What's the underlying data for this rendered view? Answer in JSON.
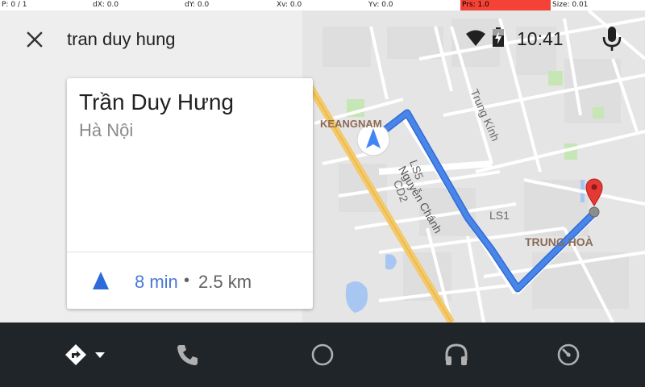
{
  "debug": {
    "p": "P: 0 / 1",
    "dx": "dX: 0.0",
    "dy": "dY: 0.0",
    "xv": "Xv: 0.0",
    "yv": "Yv: 0.0",
    "prs": "Prs: 1.0",
    "size": "Size: 0.01"
  },
  "search": {
    "query": "tran duy hung"
  },
  "status": {
    "time": "10:41"
  },
  "result": {
    "title": "Trần Duy Hưng",
    "subtitle": "Hà Nội",
    "duration": "8 min",
    "separator": "•",
    "distance": "2.5 km"
  },
  "map": {
    "labels": {
      "keangnam": "KEANGNAM",
      "nguyen_chanh": "Nguyễn Chánh",
      "ls5": "LS5",
      "cd2": "CD2",
      "trung_kinh": "Trung Kính",
      "ls1": "LS1",
      "trung_hoa": "TRUNG HOÀ"
    },
    "route_color": "#4a86e8",
    "destination_pin_color": "#e53935"
  },
  "icons": {
    "close": "close-icon",
    "wifi": "wifi-icon",
    "battery": "battery-charging-icon",
    "mic": "microphone-icon",
    "nav_arrow": "navigation-arrow-icon",
    "navigation_app": "directions-icon",
    "phone": "phone-icon",
    "home": "home-circle-icon",
    "music": "headphones-icon",
    "overview": "gauge-icon"
  },
  "colors": {
    "bottom_bar": "#20252a",
    "accent": "#4a78d6",
    "prs_bar": "#f44336"
  }
}
